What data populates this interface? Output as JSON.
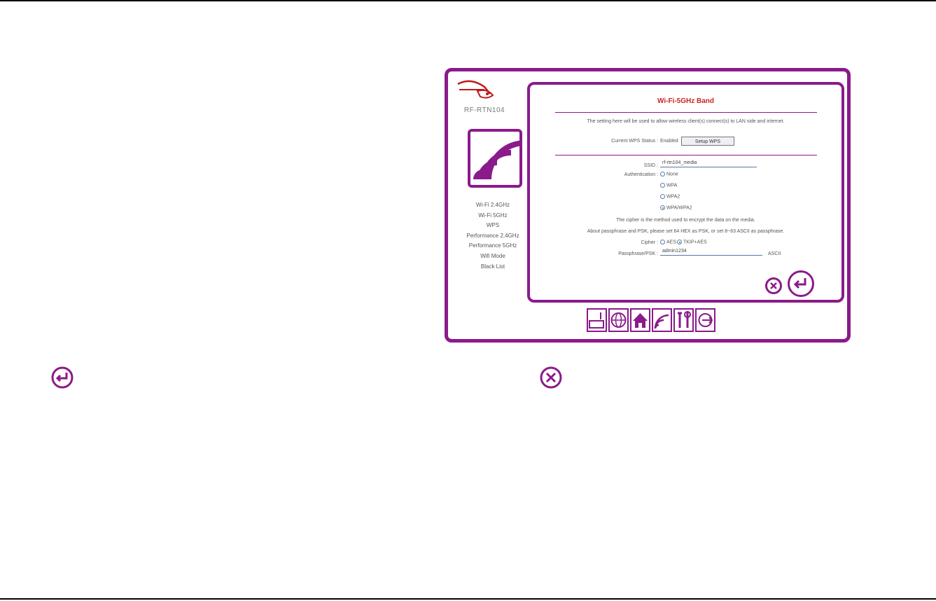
{
  "router": {
    "model": "RF-RTN104",
    "menu": [
      "Wi-Fi 2.4GHz",
      "Wi-Fi 5GHz",
      "WPS",
      "Performance 2.4GHz",
      "Performance 5GHz",
      "Wifi Mode",
      "Black List"
    ],
    "panel": {
      "title": "Wi-Fi-5GHz Band",
      "description": "The setting here will be used to allow wireless client(s) connect(s) to LAN side and internet.",
      "wps_status_label": "Current WPS Status :",
      "wps_status_value": "Enabled",
      "wps_button": "Setup WPS",
      "ssid_label": "SSID :",
      "ssid_value": "rf-rtn104_media",
      "auth_label": "Authentication :",
      "auth_options": [
        "None",
        "WPA",
        "WPA2",
        "WPA/WPA2"
      ],
      "auth_selected": "WPA/WPA2",
      "cipher_note": "The cipher is the method used to encrypt the data on the media.",
      "psk_note": "About passphrase and PSK, please set 64 HEX as PSK, or set 8~63 ASCII as passphrase.",
      "cipher_label": "Cipher :",
      "cipher_options": [
        "AES",
        "TKIP+AES"
      ],
      "cipher_selected": "TKIP+AES",
      "passphrase_label": "Passphrase/PSK :",
      "passphrase_value": "admin1234",
      "passphrase_type": "ASCII"
    },
    "bottom_icons": [
      "router-status-icon",
      "internet-globe-icon",
      "home-icon",
      "wifi-icon",
      "tools-icon",
      "logout-icon"
    ]
  },
  "colors": {
    "frame": "#8b1a8b",
    "title": "#cc2222",
    "radio_on": "#2a8a2a"
  },
  "legend": {
    "apply_icon": "enter-arrow-icon",
    "cancel_icon": "cancel-x-icon"
  }
}
